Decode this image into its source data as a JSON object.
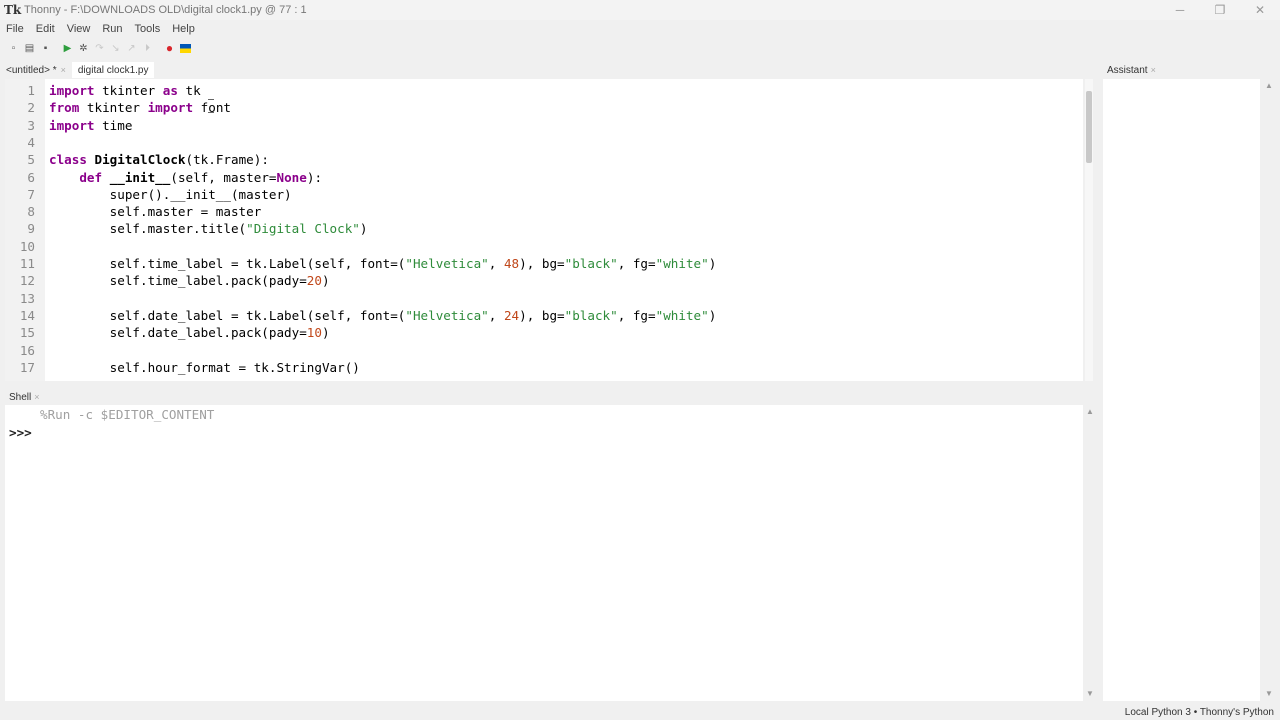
{
  "window": {
    "app_icon": "Tk",
    "title": "Thonny  -  F:\\DOWNLOADS OLD\\digital clock1.py  @  77 : 1",
    "controls": [
      "minimize-icon",
      "restore-icon",
      "close-icon"
    ]
  },
  "menu": [
    "File",
    "Edit",
    "View",
    "Run",
    "Tools",
    "Help"
  ],
  "toolbar": [
    {
      "name": "new-file-icon",
      "glyph": "▫"
    },
    {
      "name": "open-file-icon",
      "glyph": "▤"
    },
    {
      "name": "save-file-icon",
      "glyph": "▪"
    },
    {
      "name": "run-icon",
      "glyph": "▶"
    },
    {
      "name": "debug-icon",
      "glyph": "✲"
    },
    {
      "name": "step-over-icon",
      "glyph": "↷"
    },
    {
      "name": "step-into-icon",
      "glyph": "↘"
    },
    {
      "name": "step-out-icon",
      "glyph": "↗"
    },
    {
      "name": "resume-icon",
      "glyph": "⏵"
    },
    {
      "name": "stop-icon",
      "glyph": "●"
    },
    {
      "name": "ukraine-flag-icon",
      "glyph": ""
    }
  ],
  "editor_tabs": [
    {
      "label": "<untitled> *",
      "active": false
    },
    {
      "label": "digital clock1.py",
      "active": true
    }
  ],
  "code_lines": [
    {
      "n": "1",
      "html": "<span class='kw'>import</span> tkinter <span class='kw'>as</span> tk"
    },
    {
      "n": "2",
      "html": "<span class='kw'>from</span> tkinter <span class='kw'>import</span> font"
    },
    {
      "n": "3",
      "html": "<span class='kw'>import</span> time"
    },
    {
      "n": "4",
      "html": ""
    },
    {
      "n": "5",
      "html": "<span class='kw'>class</span> <span class='cls'>DigitalClock</span>(tk.Frame):"
    },
    {
      "n": "6",
      "html": "    <span class='kw'>def</span> <span class='cls'>__init__</span>(self, master=<span class='kw'>None</span>):"
    },
    {
      "n": "7",
      "html": "        super().__init__(master)"
    },
    {
      "n": "8",
      "html": "        self.master = master"
    },
    {
      "n": "9",
      "html": "        self.master.title(<span class='str'>\"Digital Clock\"</span>)"
    },
    {
      "n": "10",
      "html": ""
    },
    {
      "n": "11",
      "html": "        self.time_label = tk.Label(self, font=(<span class='str'>\"Helvetica\"</span>, <span class='num'>48</span>), bg=<span class='str'>\"black\"</span>, fg=<span class='str'>\"white\"</span>)"
    },
    {
      "n": "12",
      "html": "        self.time_label.pack(pady=<span class='num'>20</span>)"
    },
    {
      "n": "13",
      "html": ""
    },
    {
      "n": "14",
      "html": "        self.date_label = tk.Label(self, font=(<span class='str'>\"Helvetica\"</span>, <span class='num'>24</span>), bg=<span class='str'>\"black\"</span>, fg=<span class='str'>\"white\"</span>)"
    },
    {
      "n": "15",
      "html": "        self.date_label.pack(pady=<span class='num'>10</span>)"
    },
    {
      "n": "16",
      "html": ""
    },
    {
      "n": "17",
      "html": "        self.hour_format = tk.StringVar()"
    }
  ],
  "shell": {
    "tab_label": "Shell",
    "last_command": "%Run -c $EDITOR_CONTENT",
    "prompt": ">>>"
  },
  "assistant": {
    "tab_label": "Assistant"
  },
  "status": {
    "interpreter": "Local Python 3  •  Thonny's Python"
  },
  "colors": {
    "keyword": "#8b008b",
    "string": "#2e8b3a",
    "number": "#c0471a",
    "stop_button": "#d9262c",
    "run_button": "#2e9e3e",
    "flag_blue": "#0057b7",
    "flag_yellow": "#ffd700"
  }
}
